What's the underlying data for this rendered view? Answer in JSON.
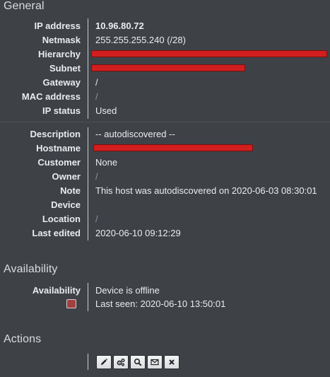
{
  "sections": {
    "general": "General",
    "availability": "Availability",
    "actions": "Actions"
  },
  "network": {
    "ip_label": "IP address",
    "ip_value": "10.96.80.72",
    "netmask_label": "Netmask",
    "netmask_value": "255.255.255.240 (/28)",
    "hierarchy_label": "Hierarchy",
    "subnet_label": "Subnet",
    "gateway_label": "Gateway",
    "gateway_value": "/",
    "mac_label": "MAC address",
    "mac_value": "/",
    "status_label": "IP status",
    "status_value": "Used"
  },
  "host": {
    "description_label": "Description",
    "description_value": "-- autodiscovered --",
    "hostname_label": "Hostname",
    "customer_label": "Customer",
    "customer_value": "None",
    "owner_label": "Owner",
    "owner_value": "/",
    "note_label": "Note",
    "note_value": "This host was autodiscovered on 2020-06-03 08:30:01",
    "device_label": "Device",
    "device_value": "",
    "location_label": "Location",
    "location_value": "/",
    "edited_label": "Last edited",
    "edited_value": "2020-06-10 09:12:29"
  },
  "availability": {
    "label": "Availability",
    "status": "Device is offline",
    "last_seen": "Last seen: 2020-06-10 13:50:01",
    "status_color": "#a04040"
  },
  "actions": {
    "buttons": [
      "edit-icon",
      "cogs-icon",
      "search-icon",
      "envelope-icon",
      "close-icon"
    ]
  },
  "colors": {
    "background": "#3e4247",
    "redaction": "#d21e1e"
  }
}
